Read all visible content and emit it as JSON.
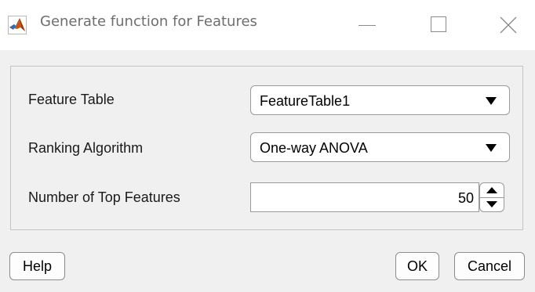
{
  "window": {
    "title": "Generate function for Features",
    "controls": {
      "minimize": "minimize-icon",
      "maximize": "maximize-icon",
      "close": "close-icon"
    }
  },
  "form": {
    "feature_table": {
      "label": "Feature Table",
      "value": "FeatureTable1"
    },
    "ranking_algorithm": {
      "label": "Ranking Algorithm",
      "value": "One-way ANOVA"
    },
    "top_features": {
      "label": "Number of Top Features",
      "value": "50"
    }
  },
  "buttons": {
    "help": "Help",
    "ok": "OK",
    "cancel": "Cancel"
  },
  "colors": {
    "window_bg": "#f0f0f0",
    "titlebar_bg": "#ffffff",
    "title_text": "#6e6e6e",
    "border": "#9a9a9a"
  }
}
